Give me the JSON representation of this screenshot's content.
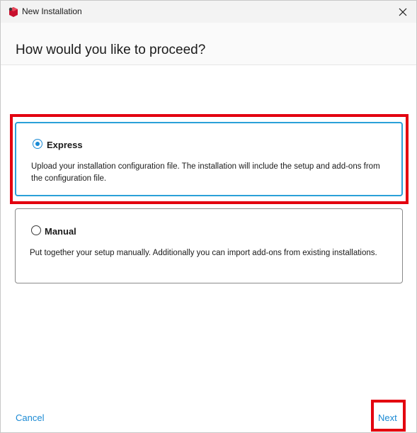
{
  "window": {
    "title": "New Installation",
    "icon": "app-logo-icon"
  },
  "header": {
    "title": "How would you like to proceed?"
  },
  "options": [
    {
      "label": "Express",
      "description": "Upload your installation configuration file. The installation will include the setup and add-ons from the configuration file.",
      "selected": true
    },
    {
      "label": "Manual",
      "description": "Put together your setup manually. Additionally you can import add-ons from existing installations.",
      "selected": false
    }
  ],
  "footer": {
    "cancel_label": "Cancel",
    "next_label": "Next"
  },
  "colors": {
    "accent": "#1a8ad4",
    "selected_border": "#2aa0d8",
    "highlight": "#e3000f"
  }
}
